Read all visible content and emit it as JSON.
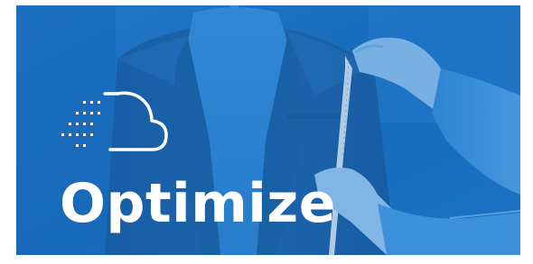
{
  "banner": {
    "headline": "Optimize",
    "icon": "cloud-speed-icon",
    "colors": {
      "overlay": "#1a6fc0",
      "text": "#ffffff",
      "page_background": "#ffffff"
    }
  }
}
